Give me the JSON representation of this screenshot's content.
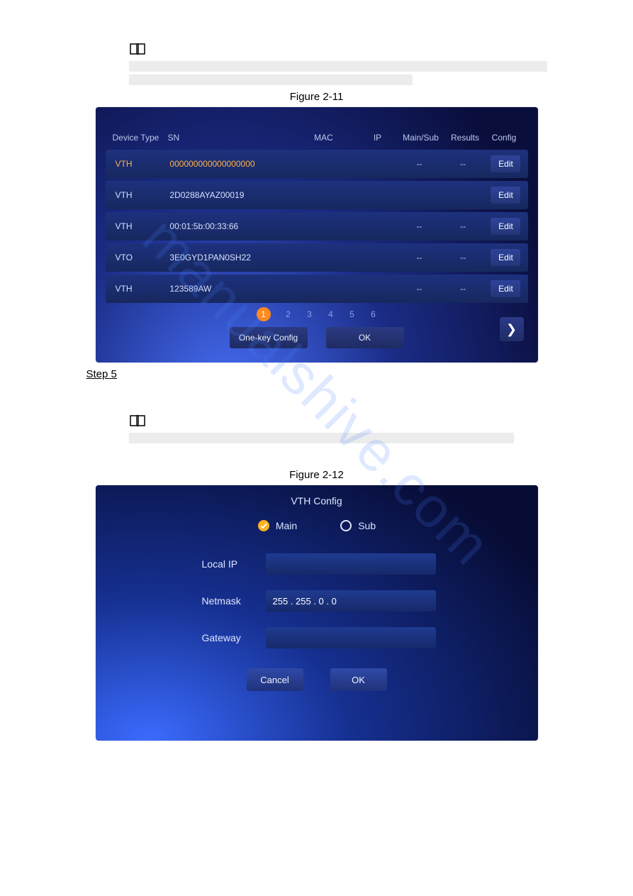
{
  "figure_1_caption": "Figure 2-11",
  "figure_2_caption": "Figure 2-12",
  "step_label": "Step 5",
  "watermark": "manualshive.com",
  "fig1": {
    "headers": {
      "type": "Device Type",
      "sn": "SN",
      "mac": "MAC",
      "ip": "IP",
      "ms": "Main/Sub",
      "res": "Results",
      "cfg": "Config"
    },
    "rows": [
      {
        "type": "VTH",
        "sn": "000000000000000000",
        "ms": "--",
        "res": "--",
        "edit": "Edit"
      },
      {
        "type": "VTH",
        "sn": "2D0288AYAZ00019",
        "ms": "",
        "res": "",
        "edit": "Edit"
      },
      {
        "type": "VTH",
        "sn": "00:01:5b:00:33:66",
        "ms": "--",
        "res": "--",
        "edit": "Edit"
      },
      {
        "type": "VTO",
        "sn": "3E0GYD1PAN0SH22",
        "ms": "--",
        "res": "--",
        "edit": "Edit"
      },
      {
        "type": "VTH",
        "sn": "123589AW",
        "ms": "--",
        "res": "--",
        "edit": "Edit"
      }
    ],
    "pages": [
      "1",
      "2",
      "3",
      "4",
      "5",
      "6"
    ],
    "one_key": "One-key Config",
    "ok": "OK"
  },
  "fig2": {
    "title": "VTH Config",
    "main": "Main",
    "sub": "Sub",
    "local_ip": "Local IP",
    "netmask_label": "Netmask",
    "netmask_value": "255 . 255 .  0  .  0",
    "gateway": "Gateway",
    "cancel": "Cancel",
    "ok": "OK"
  }
}
